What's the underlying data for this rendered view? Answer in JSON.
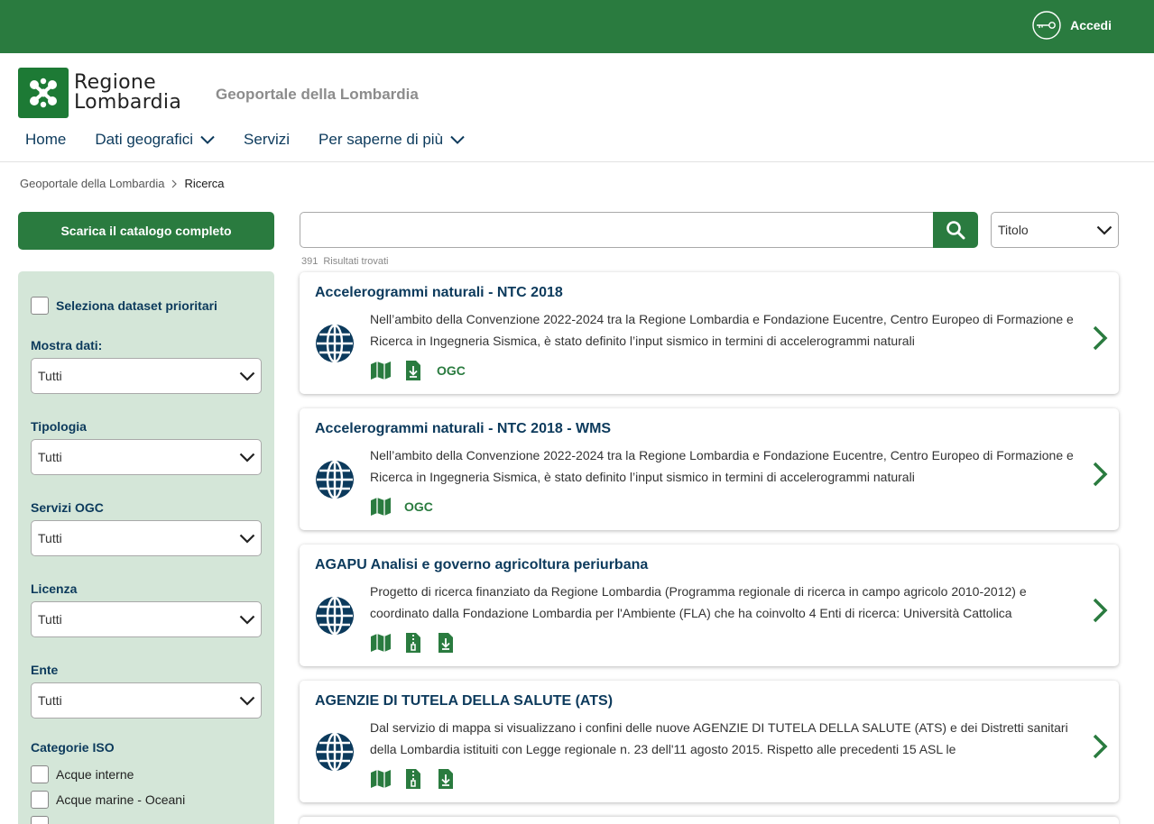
{
  "topbar": {
    "login_label": "Accedi",
    "login_icon": "key-circle-icon"
  },
  "header": {
    "logo_line1": "Regione",
    "logo_line2": "Lombardia",
    "portal_name": "Geoportale della Lombardia",
    "nav": [
      {
        "label": "Home",
        "dropdown": false
      },
      {
        "label": "Dati geografici",
        "dropdown": true
      },
      {
        "label": "Servizi",
        "dropdown": false
      },
      {
        "label": "Per saperne di più",
        "dropdown": true
      }
    ]
  },
  "breadcrumb": {
    "parent": "Geoportale della Lombardia",
    "current": "Ricerca"
  },
  "sidebar": {
    "download_label": "Scarica il catalogo completo",
    "priority_label": "Seleziona dataset prioritari",
    "filters": [
      {
        "label": "Mostra dati:",
        "value": "Tutti"
      },
      {
        "label": "Tipologia",
        "value": "Tutti"
      },
      {
        "label": "Servizi OGC",
        "value": "Tutti"
      },
      {
        "label": "Licenza",
        "value": "Tutti"
      },
      {
        "label": "Ente",
        "value": "Tutti"
      }
    ],
    "iso_label": "Categorie ISO",
    "iso_items": [
      "Acque interne",
      "Acque marine - Oceani"
    ]
  },
  "search": {
    "value": "",
    "placeholder": "",
    "sort_value": "Titolo"
  },
  "results_info": {
    "count": "391",
    "label": "Risultati trovati"
  },
  "results": [
    {
      "title": "Accelerogrammi naturali - NTC 2018",
      "desc": "Nell’ambito della Convenzione 2022-2024 tra la Regione Lombardia e Fondazione Eucentre, Centro Europeo di Formazione e Ricerca in Ingegneria Sismica, è stato definito l’input sismico in termini di accelerogrammi naturali",
      "ogc": "OGC"
    },
    {
      "title": "Accelerogrammi naturali - NTC 2018 - WMS",
      "desc": "Nell’ambito della Convenzione 2022-2024 tra la Regione Lombardia e Fondazione Eucentre, Centro Europeo di Formazione e Ricerca in Ingegneria Sismica, è stato definito l’input sismico in termini di accelerogrammi naturali",
      "ogc": "OGC"
    },
    {
      "title": "AGAPU Analisi e governo agricoltura periurbana",
      "desc": "Progetto di ricerca finanziato da Regione Lombardia (Programma regionale di ricerca in campo agricolo 2010-2012) e coordinato dalla Fondazione Lombardia per l'Ambiente (FLA) che ha coinvolto 4 Enti di ricerca: Università Cattolica"
    },
    {
      "title": "AGENZIE DI TUTELA DELLA SALUTE (ATS)",
      "desc": "Dal servizio di mappa si visualizzano i confini delle nuove AGENZIE DI TUTELA DELLA SALUTE (ATS) e dei Distretti sanitari della Lombardia istituiti con Legge regionale n. 23 dell'11 agosto 2015. Rispetto alle precedenti 15 ASL le"
    }
  ],
  "colors": {
    "primary_green": "#2a7b3f",
    "navy": "#0c3a5c",
    "sidebar_bg": "#d4e6d8"
  }
}
